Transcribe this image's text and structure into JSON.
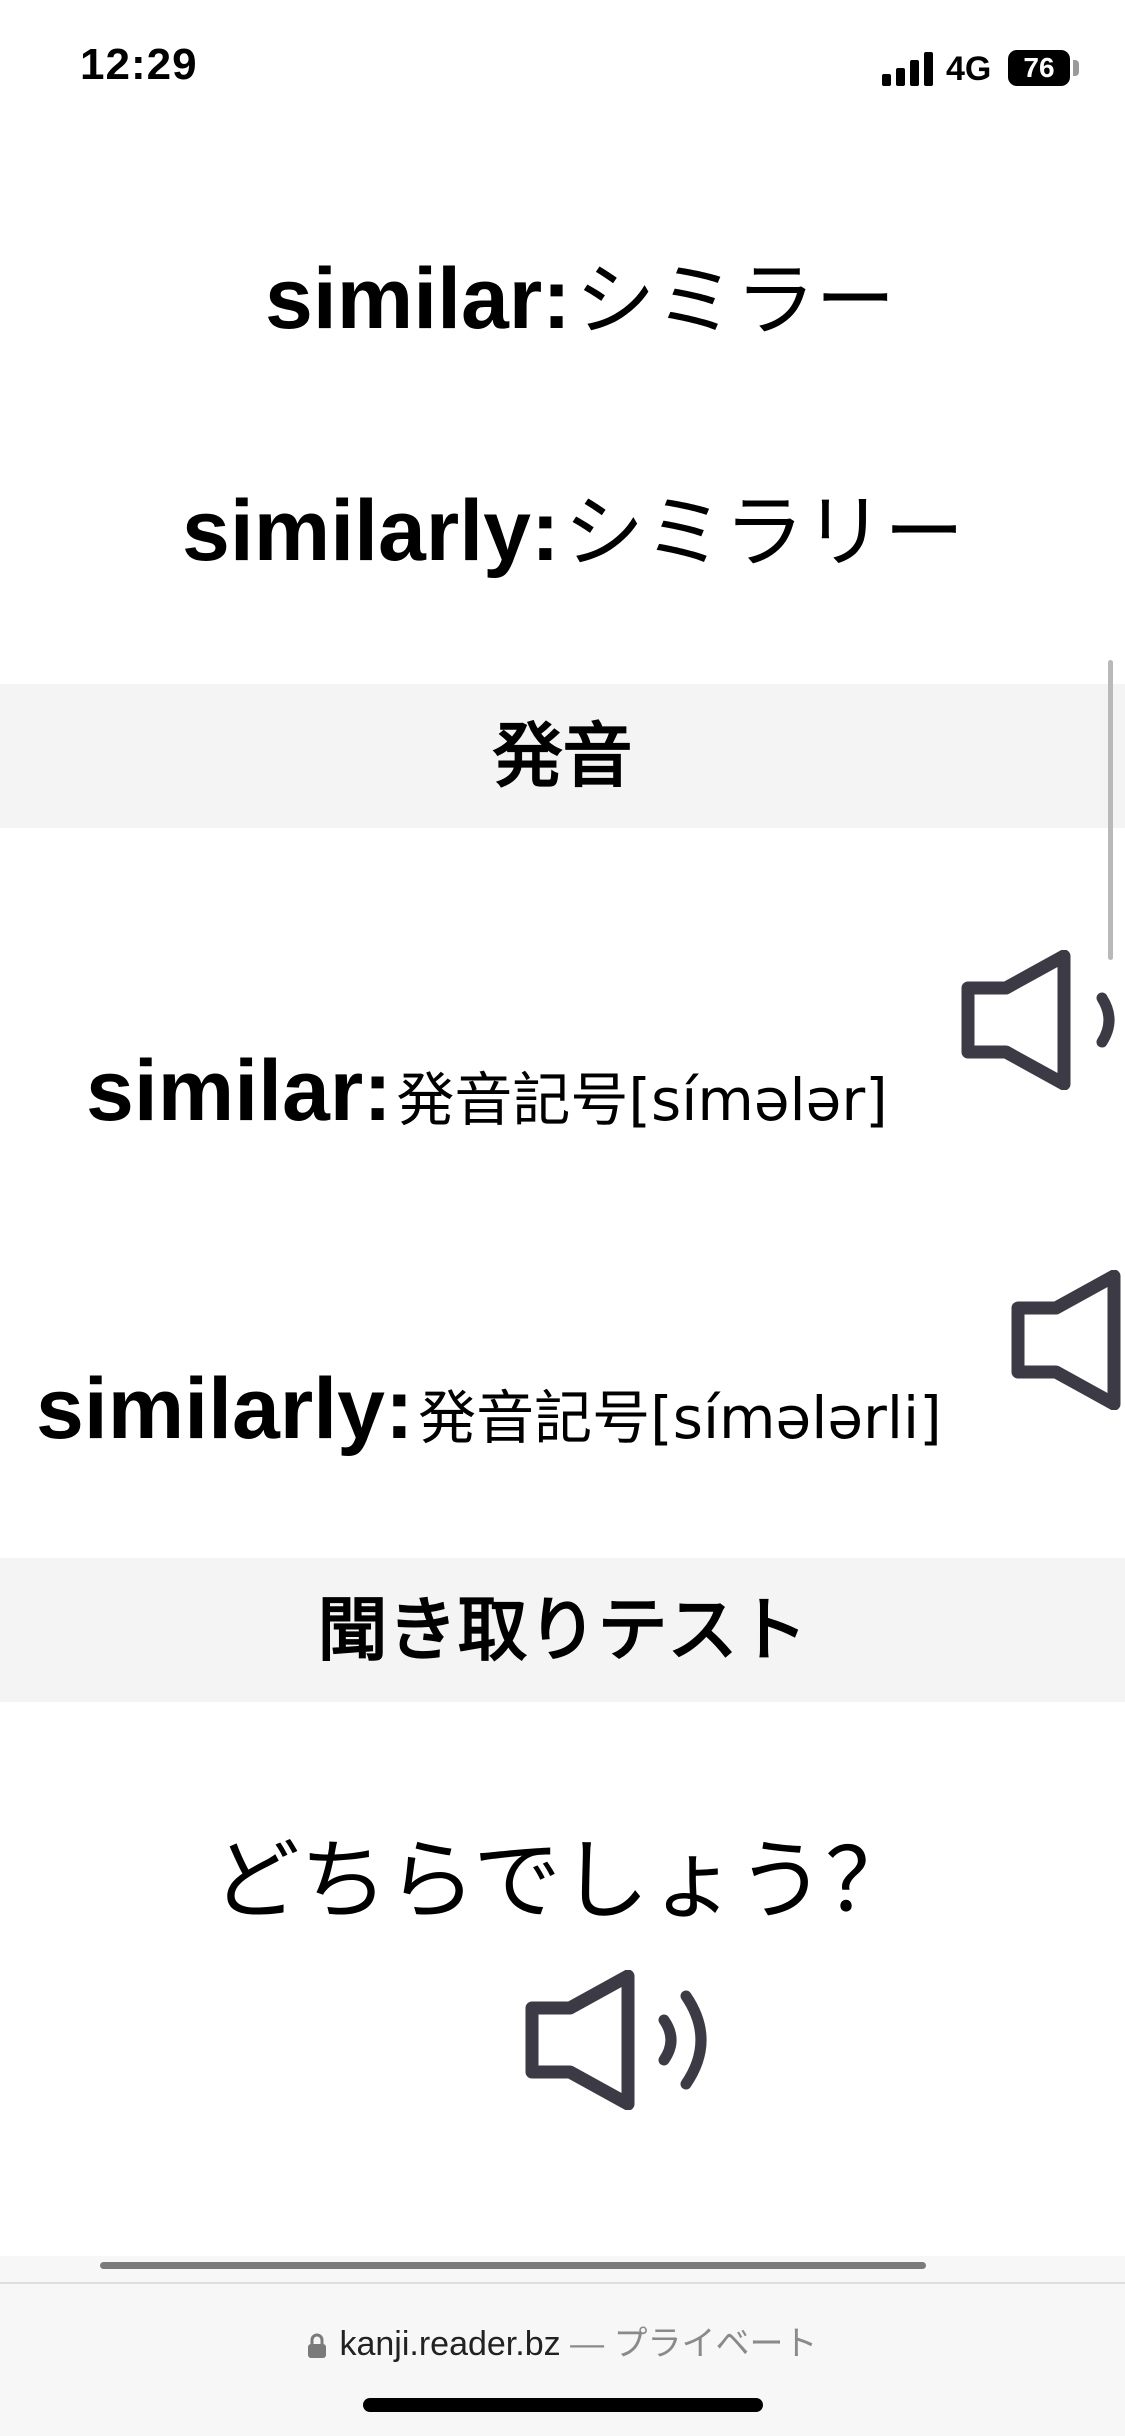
{
  "status_bar": {
    "time": "12:29",
    "network": "4G",
    "battery": "76"
  },
  "katakana_section": {
    "rows": [
      {
        "word": "similar:",
        "reading": "シミラー"
      },
      {
        "word": "similarly:",
        "reading": "シミラリー"
      }
    ]
  },
  "pronunciation_section": {
    "title": "発音",
    "rows": [
      {
        "word": "similar:",
        "ipa": "発音記号[símələr]"
      },
      {
        "word": "similarly:",
        "ipa": "発音記号[símələrli]"
      }
    ]
  },
  "listening_section": {
    "title": "聞き取りテスト",
    "question": "どちらでしょう？"
  },
  "browser": {
    "url": "kanji.reader.bz",
    "privacy_label": "— プライベート"
  },
  "icons": {
    "speaker": "speaker-icon",
    "lock": "lock-icon"
  }
}
